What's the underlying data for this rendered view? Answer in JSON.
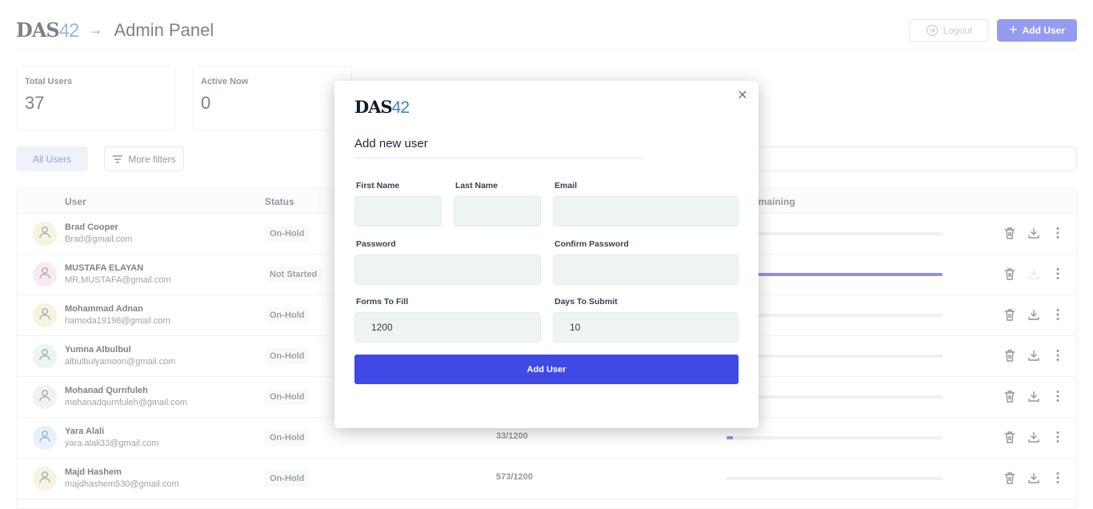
{
  "header": {
    "logo_das": "DAS",
    "logo_num": "42",
    "title": "Admin Panel",
    "logout_label": "Logout",
    "add_user_label": "Add User"
  },
  "stats": [
    {
      "label": "Total Users",
      "value": "37"
    },
    {
      "label": "Active Now",
      "value": "0"
    }
  ],
  "filters": {
    "all_users": "All Users",
    "more_filters": "More filters"
  },
  "table": {
    "headers": {
      "user": "User",
      "status": "Status",
      "remaining": "emaining"
    },
    "rows": [
      {
        "name": "Brad Cooper",
        "email": "Brad@gmail.com",
        "status": "On-Hold",
        "forms": "",
        "progress": 0.1,
        "avatar_color": "#f3e7c9",
        "icon_color": "#6b7280"
      },
      {
        "name": "MUSTAFA ELAYAN",
        "email": "MR.MUSTAFA@gmail.com",
        "status": "Not Started",
        "forms": "",
        "progress": 1.0,
        "avatar_color": "#f7d6e4",
        "icon_color": "#6b7280"
      },
      {
        "name": "Mohammad Adnan",
        "email": "hamoda19198@gmail.com",
        "status": "On-Hold",
        "forms": "",
        "progress": 0.0,
        "avatar_color": "#f3e7c9",
        "icon_color": "#6b7280"
      },
      {
        "name": "Yumna Albulbul",
        "email": "albulbulyamoon@gmail.com",
        "status": "On-Hold",
        "forms": "",
        "progress": 0.0,
        "avatar_color": "#d9efe2",
        "icon_color": "#6b7280"
      },
      {
        "name": "Mohanad Qurnfuleh",
        "email": "mohanadqurnfuleh@gmail.com",
        "status": "On-Hold",
        "forms": "",
        "progress": 0.0,
        "avatar_color": "#e5e7eb",
        "icon_color": "#6b7280"
      },
      {
        "name": "Yara Alali",
        "email": "yara.alali33@gmail.com",
        "status": "On-Hold",
        "forms": "33/1200",
        "progress": 0.03,
        "avatar_color": "#d6e6f7",
        "icon_color": "#3b82c4"
      },
      {
        "name": "Majd Hashem",
        "email": "majdhashem530@gmail.com",
        "status": "On-Hold",
        "forms": "573/1200",
        "progress": 0.0,
        "avatar_color": "#f3e7c9",
        "icon_color": "#6b7280"
      }
    ]
  },
  "modal": {
    "logo_das": "DAS",
    "logo_num": "42",
    "title": "Add new user",
    "close_glyph": "×",
    "labels": {
      "first_name": "First Name",
      "last_name": "Last Name",
      "email": "Email",
      "password": "Password",
      "confirm_password": "Confirm Password",
      "forms_to_fill": "Forms To Fill",
      "days_to_submit": "Days To Submit"
    },
    "values": {
      "first_name": "",
      "last_name": "",
      "email": "",
      "password": "",
      "confirm_password": "",
      "forms_to_fill": "1200",
      "days_to_submit": "10"
    },
    "submit_label": "Add User"
  },
  "colors": {
    "accent": "#3f49e3",
    "field_bg": "#eef4f1"
  }
}
